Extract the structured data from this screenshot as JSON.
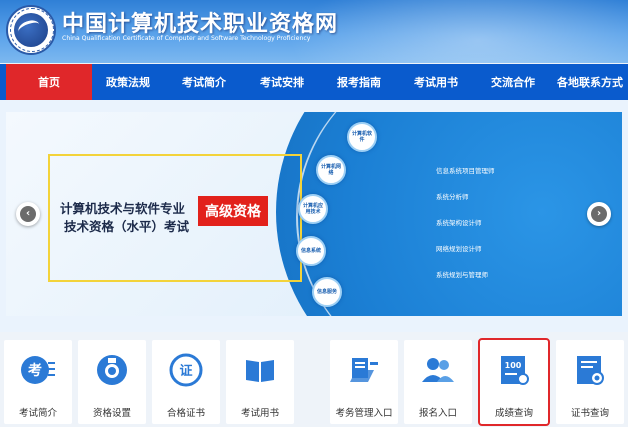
{
  "header": {
    "title": "中国计算机技术职业资格网",
    "subtitle": "China Qualification Certificate of Computer and Software Technology Proficiency"
  },
  "nav": {
    "items": [
      {
        "label": "首页"
      },
      {
        "label": "政策法规"
      },
      {
        "label": "考试简介"
      },
      {
        "label": "考试安排"
      },
      {
        "label": "报考指南"
      },
      {
        "label": "考试用书"
      },
      {
        "label": "交流合作"
      },
      {
        "label": "各地联系方式"
      }
    ]
  },
  "banner": {
    "line1": "计算机技术与软件专业",
    "line2": "技术资格（水平）考试",
    "badge": "高级资格",
    "nodes": [
      {
        "label": "计算机软件"
      },
      {
        "label": "计算机网络"
      },
      {
        "label": "计算机应用技术"
      },
      {
        "label": "信息系统"
      },
      {
        "label": "信息服务"
      }
    ],
    "roles": [
      {
        "label": "信息系统项目管理师"
      },
      {
        "label": "系统分析师"
      },
      {
        "label": "系统架构设计师"
      },
      {
        "label": "网络规划设计师"
      },
      {
        "label": "系统规划与管理师"
      }
    ],
    "prev": "‹",
    "next": "›"
  },
  "tiles": [
    {
      "label": "考试简介",
      "icon": "exam-intro-icon"
    },
    {
      "label": "资格设置",
      "icon": "qualification-icon"
    },
    {
      "label": "合格证书",
      "icon": "certificate-icon"
    },
    {
      "label": "考试用书",
      "icon": "book-icon"
    },
    {
      "label": "考务管理入口",
      "icon": "management-icon"
    },
    {
      "label": "报名入口",
      "icon": "registration-icon"
    },
    {
      "label": "成绩查询",
      "icon": "score-query-icon"
    },
    {
      "label": "证书查询",
      "icon": "certificate-query-icon"
    }
  ],
  "tile_glyphs": {
    "exam": "考",
    "cert": "证",
    "score": "100"
  },
  "colors": {
    "nav_bg": "#0a5bcd",
    "nav_active": "#e0272a",
    "badge": "#e2211b",
    "frame": "#f3d33a"
  }
}
